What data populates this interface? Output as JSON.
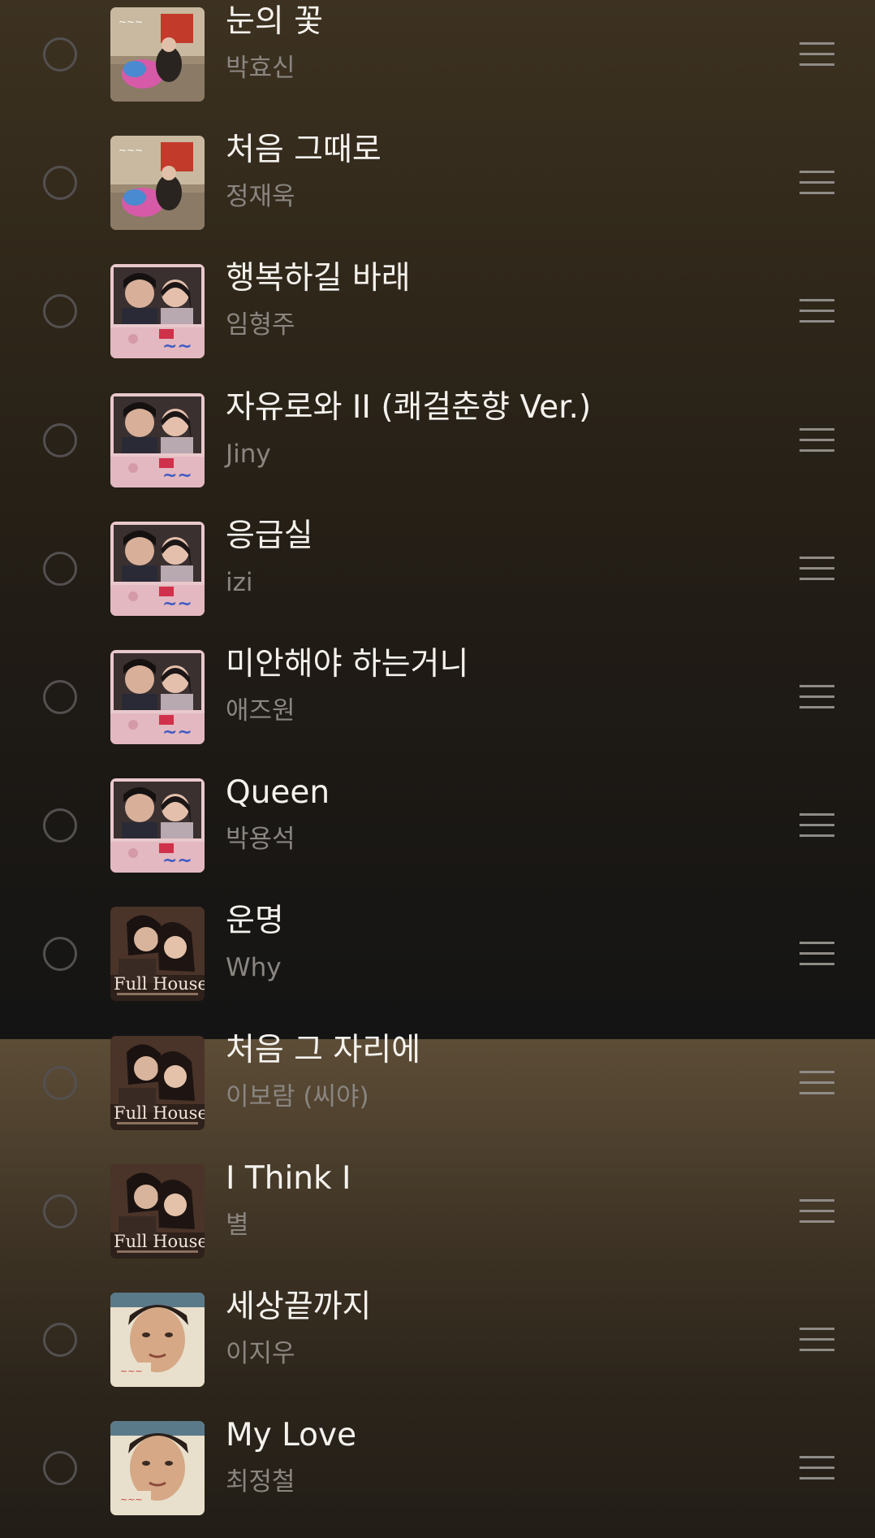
{
  "playlist": {
    "items": [
      {
        "title": "눈의 꽃",
        "artist": "박효신",
        "art": "street"
      },
      {
        "title": "처음 그때로",
        "artist": "정재욱",
        "art": "street"
      },
      {
        "title": "행복하길 바래",
        "artist": "임형주",
        "art": "chunhyang"
      },
      {
        "title": "자유로와 II  (쾌걸춘향 Ver.)",
        "artist": "Jiny",
        "art": "chunhyang"
      },
      {
        "title": "응급실",
        "artist": "izi",
        "art": "chunhyang"
      },
      {
        "title": "미안해야 하는거니",
        "artist": "애즈원",
        "art": "chunhyang"
      },
      {
        "title": "Queen",
        "artist": "박용석",
        "art": "chunhyang"
      },
      {
        "title": "운명",
        "artist": "Why",
        "art": "fullhouse"
      },
      {
        "title": "처음 그 자리에",
        "artist": "이보람 (씨야)",
        "art": "fullhouse"
      },
      {
        "title": "I Think I",
        "artist": "별",
        "art": "fullhouse"
      },
      {
        "title": "세상끝까지",
        "artist": "이지우",
        "art": "portrait"
      },
      {
        "title": "My Love",
        "artist": "최정철",
        "art": "portrait"
      }
    ]
  },
  "album_art": {
    "fullhouse_text": "Full House"
  },
  "icons": {
    "select": "radio-circle-icon",
    "reorder": "drag-handle-icon"
  },
  "colors": {
    "title_text": "#f5f2ee",
    "artist_text": "#8a8580",
    "radio_border": "#545050",
    "handle": "#8f8b86"
  }
}
